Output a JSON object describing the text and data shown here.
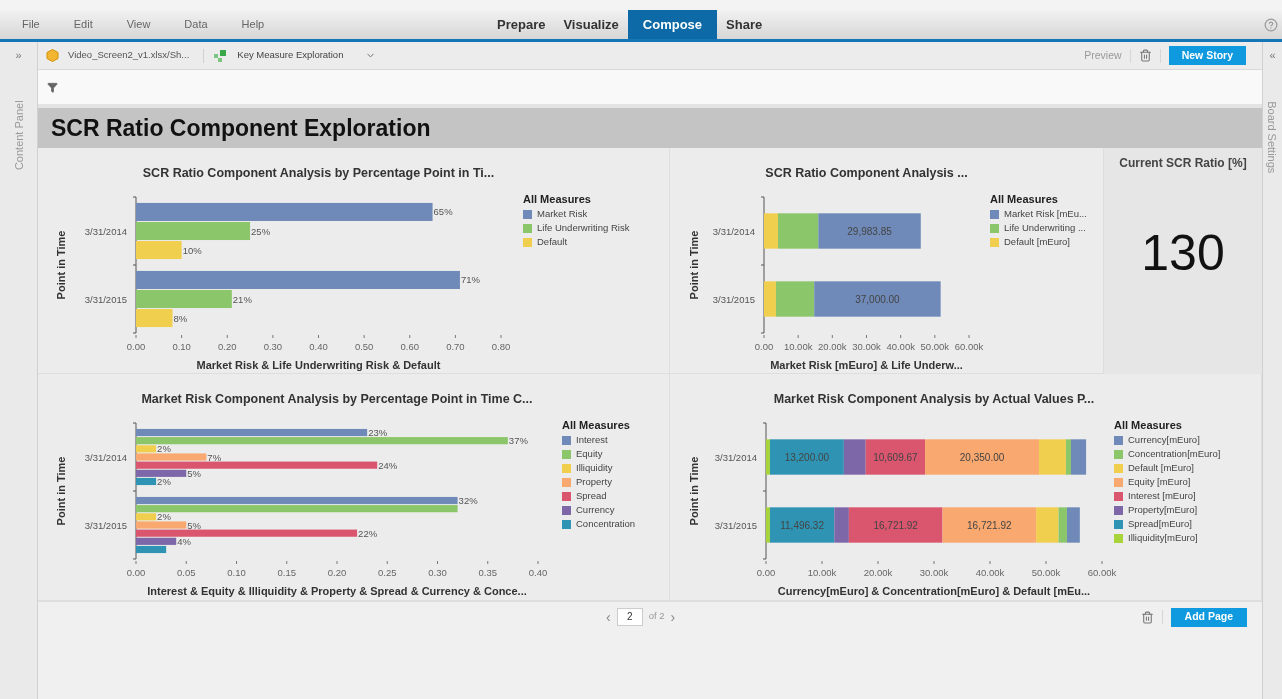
{
  "menu": [
    "File",
    "Edit",
    "View",
    "Data",
    "Help"
  ],
  "perspectives": [
    {
      "label": "Prepare",
      "selected": false
    },
    {
      "label": "Visualize",
      "selected": false
    },
    {
      "label": "Compose",
      "selected": true
    },
    {
      "label": "Share",
      "selected": false
    }
  ],
  "left_panel": {
    "toggle": "»",
    "label": "Content Panel"
  },
  "right_panel": {
    "toggle": "«",
    "label": "Board Settings"
  },
  "toolbar": {
    "dataset": "Video_Screen2_v1.xlsx/Sh...",
    "story": "Key Measure Exploration",
    "preview": "Preview",
    "new_story": "New Story"
  },
  "board_title": "SCR Ratio Component Exploration",
  "charts": [
    {
      "legend_title": "All Measures",
      "chart_data": {
        "type": "bar",
        "orientation": "horizontal",
        "title": "SCR Ratio Component Analysis by Percentage Point in Ti...",
        "xlabel": "Market Risk & Life Underwriting Risk & Default",
        "ylabel": "Point in Time",
        "categories": [
          "3/31/2014",
          "3/31/2015"
        ],
        "xlim": [
          0,
          0.8
        ],
        "xticks": [
          {
            "value": 0,
            "label": "0.00"
          },
          {
            "value": 0.1,
            "label": "0.10"
          },
          {
            "value": 0.2,
            "label": "0.20"
          },
          {
            "value": 0.3,
            "label": "0.30"
          },
          {
            "value": 0.4,
            "label": "0.40"
          },
          {
            "value": 0.5,
            "label": "0.50"
          },
          {
            "value": 0.6,
            "label": "0.60"
          },
          {
            "value": 0.7,
            "label": "0.70"
          },
          {
            "value": 0.8,
            "label": "0.80"
          }
        ],
        "stacked": false,
        "series": [
          {
            "name": "Market Risk",
            "color": "#6f8ab8",
            "values": [
              0.65,
              0.71
            ],
            "value_labels": [
              "65%",
              "71%"
            ]
          },
          {
            "name": "Life Underwriting Risk",
            "color": "#8cc66a",
            "values": [
              0.25,
              0.21
            ],
            "value_labels": [
              "25%",
              "21%"
            ]
          },
          {
            "name": "Default",
            "color": "#f0cf4f",
            "values": [
              0.1,
              0.08
            ],
            "value_labels": [
              "10%",
              "8%"
            ]
          }
        ]
      }
    },
    {
      "legend_title": "All Measures",
      "chart_data": {
        "type": "bar",
        "orientation": "horizontal",
        "title": "SCR Ratio Component Analysis ...",
        "xlabel": "Market Risk [mEuro] & Life Underw...",
        "ylabel": "Point in Time",
        "categories": [
          "3/31/2014",
          "3/31/2015"
        ],
        "xlim": [
          0,
          60000
        ],
        "xticks": [
          {
            "value": 0,
            "label": "0.00"
          },
          {
            "value": 10000,
            "label": "10.00k"
          },
          {
            "value": 20000,
            "label": "20.00k"
          },
          {
            "value": 30000,
            "label": "30.00k"
          },
          {
            "value": 40000,
            "label": "40.00k"
          },
          {
            "value": 50000,
            "label": "50.00k"
          },
          {
            "value": 60000,
            "label": "60.00k"
          }
        ],
        "stacked": true,
        "series": [
          {
            "name": "Market Risk [mEu...",
            "color": "#6f8ab8",
            "values": [
              29983.85,
              37000
            ],
            "value_labels": [
              "29,983.85",
              "37,000.00"
            ]
          },
          {
            "name": "Life Underwriting ...",
            "color": "#8cc66a",
            "values": [
              11800,
              11200
            ]
          },
          {
            "name": "Default [mEuro]",
            "color": "#f0cf4f",
            "values": [
              4100,
              3500
            ]
          }
        ]
      }
    },
    {
      "legend_title": "All Measures",
      "chart_data": {
        "type": "bar",
        "orientation": "horizontal",
        "title": "Market Risk Component Analysis by Percentage Point in Time C...",
        "xlabel": "Interest & Equity & Illiquidity & Property & Spread & Currency & Conce...",
        "ylabel": "Point in Time",
        "categories": [
          "3/31/2014",
          "3/31/2015"
        ],
        "xlim": [
          0,
          0.4
        ],
        "xticks": [
          {
            "value": 0,
            "label": "0.00"
          },
          {
            "value": 0.05,
            "label": "0.05"
          },
          {
            "value": 0.1,
            "label": "0.10"
          },
          {
            "value": 0.15,
            "label": "0.15"
          },
          {
            "value": 0.2,
            "label": "0.20"
          },
          {
            "value": 0.25,
            "label": "0.25"
          },
          {
            "value": 0.3,
            "label": "0.30"
          },
          {
            "value": 0.35,
            "label": "0.35"
          },
          {
            "value": 0.4,
            "label": "0.40"
          }
        ],
        "stacked": false,
        "series": [
          {
            "name": "Interest",
            "color": "#6f8ab8",
            "values": [
              0.23,
              0.32
            ],
            "value_labels": [
              "23%",
              "32%"
            ]
          },
          {
            "name": "Equity",
            "color": "#8cc66a",
            "values": [
              0.37,
              0.32
            ],
            "value_labels": [
              "37%",
              null
            ]
          },
          {
            "name": "Illiquidity",
            "color": "#f0cf4f",
            "values": [
              0.02,
              0.02
            ],
            "value_labels": [
              "2%",
              "2%"
            ]
          },
          {
            "name": "Property",
            "color": "#f9a870",
            "values": [
              0.07,
              0.05
            ],
            "value_labels": [
              "7%",
              "5%"
            ]
          },
          {
            "name": "Spread",
            "color": "#d9566e",
            "values": [
              0.24,
              0.22
            ],
            "value_labels": [
              "24%",
              "22%"
            ]
          },
          {
            "name": "Currency",
            "color": "#7d67a8",
            "values": [
              0.05,
              0.04
            ],
            "value_labels": [
              "5%",
              "4%"
            ]
          },
          {
            "name": "Concentration",
            "color": "#2f94b3",
            "values": [
              0.02,
              0.03
            ],
            "value_labels": [
              "2%",
              null
            ]
          }
        ]
      }
    },
    {
      "legend_title": "All Measures",
      "chart_data": {
        "type": "bar",
        "orientation": "horizontal",
        "title": "Market Risk Component Analysis by Actual Values P...",
        "xlabel": "Currency[mEuro] & Concentration[mEuro] & Default [mEu...",
        "ylabel": "Point in Time",
        "categories": [
          "3/31/2014",
          "3/31/2015"
        ],
        "xlim": [
          0,
          60000
        ],
        "xticks": [
          {
            "value": 0,
            "label": "0.00"
          },
          {
            "value": 10000,
            "label": "10.00k"
          },
          {
            "value": 20000,
            "label": "20.00k"
          },
          {
            "value": 30000,
            "label": "30.00k"
          },
          {
            "value": 40000,
            "label": "40.00k"
          },
          {
            "value": 50000,
            "label": "50.00k"
          },
          {
            "value": 60000,
            "label": "60.00k"
          }
        ],
        "stacked": true,
        "series": [
          {
            "name": "Currency[mEuro]",
            "color": "#6f8ab8",
            "values": [
              2700,
              2300
            ]
          },
          {
            "name": "Concentration[mEuro]",
            "color": "#8cc66a",
            "values": [
              900,
              1500
            ]
          },
          {
            "name": "Default [mEuro]",
            "color": "#f0cf4f",
            "values": [
              4800,
              4000
            ]
          },
          {
            "name": "Equity [mEuro]",
            "color": "#f9a870",
            "values": [
              20350,
              16721.92
            ],
            "value_labels": [
              "20,350.00",
              "16,721.92"
            ]
          },
          {
            "name": "Interest [mEuro]",
            "color": "#d9566e",
            "values": [
              10609.67,
              16721.92
            ],
            "value_labels": [
              "10,609.67",
              "16,721.92"
            ]
          },
          {
            "name": "Property[mEuro]",
            "color": "#7d67a8",
            "values": [
              3900,
              2600
            ]
          },
          {
            "name": "Spread[mEuro]",
            "color": "#2f94b3",
            "values": [
              13200,
              11496.32
            ],
            "value_labels": [
              "13,200.00",
              "11,496.32"
            ]
          },
          {
            "name": "Illiquidity[mEuro]",
            "color": "#a8d43a",
            "values": [
              700,
              700
            ]
          }
        ]
      }
    }
  ],
  "kpi": {
    "title": "Current SCR Ratio [%]",
    "value": "130"
  },
  "pager": {
    "prev": "‹",
    "page": "2",
    "total": "of 2",
    "next": "›"
  },
  "add_page": "Add Page"
}
